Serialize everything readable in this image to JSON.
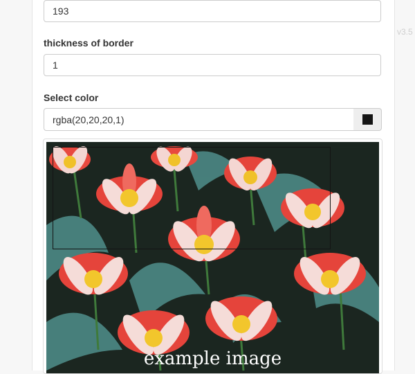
{
  "version": "v3.5",
  "fields": {
    "top_value": "193",
    "thickness_label": "thickness of border",
    "thickness_value": "1",
    "color_label": "Select color",
    "color_value": "rgba(20,20,20,1)",
    "swatch_color": "#141414"
  },
  "image": {
    "caption": "example image"
  }
}
